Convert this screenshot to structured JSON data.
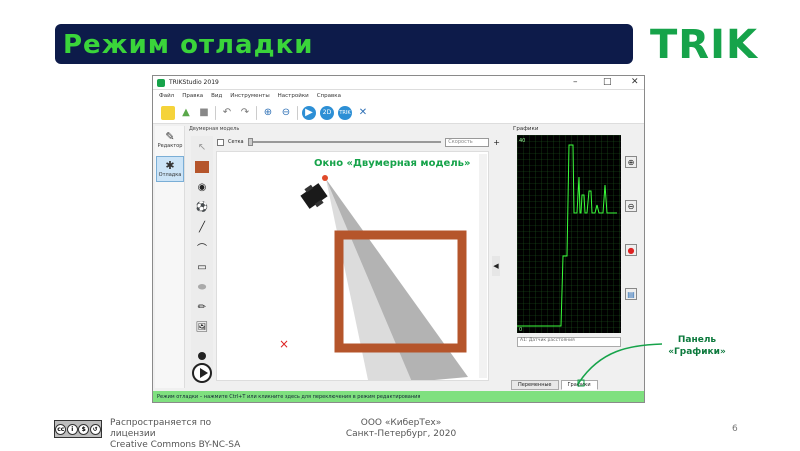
{
  "slide": {
    "title": "Режим отладки",
    "logo": "TRIK",
    "page_number": "6"
  },
  "window": {
    "title": "TRIKStudio 2019",
    "menu": [
      "Файл",
      "Правка",
      "Вид",
      "Инструменты",
      "Настройки",
      "Справка"
    ],
    "modes": [
      {
        "label": "Редактор",
        "icon": "pencil-icon"
      },
      {
        "label": "Отладка",
        "icon": "bug-icon"
      }
    ],
    "scene_header": "Двумерная модель",
    "grid_label": "Сетка",
    "speed_placeholder": "Скорость",
    "scene_caption": "Окно «Двумерная модель»",
    "graphics_header": "Графики",
    "sensor_select": "A1: Датчик расстояния",
    "tabs": [
      "Переменные",
      "Графики"
    ],
    "status": "Режим отладки – нажмите Ctrl+T или кликните здесь для переключения в режим редактирования"
  },
  "callout": {
    "line1": "Панель",
    "line2": "«Графики»"
  },
  "footer": {
    "license_line1": "Распространяется по",
    "license_line2": "лицензии",
    "license_line3": "Creative Commons BY-NC-SA",
    "company_line1": "ООО «КиберТех»",
    "company_line2": "Санкт-Петербург, 2020"
  },
  "colors": {
    "banner_bg": "#0d1b4a",
    "title_green": "#3ad43a",
    "logo_green": "#16a34a",
    "status_green": "#7fe07f",
    "wall": "#b5552b"
  }
}
